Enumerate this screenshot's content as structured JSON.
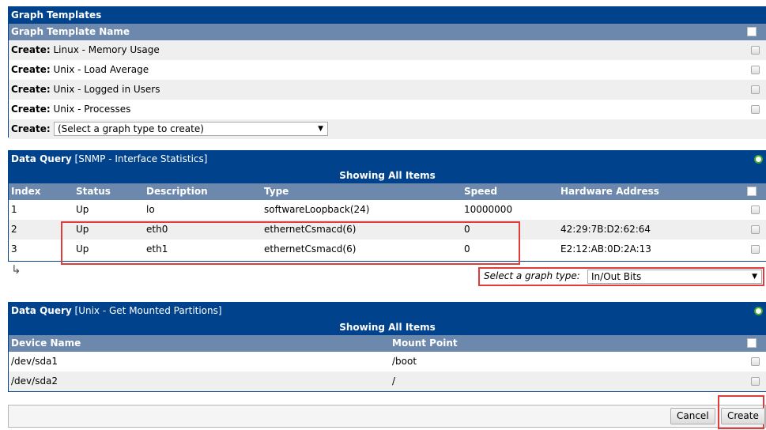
{
  "graph_templates": {
    "title": "Graph Templates",
    "column": "Graph Template Name",
    "rows": [
      {
        "prefix": "Create:",
        "name": "Linux - Memory Usage"
      },
      {
        "prefix": "Create:",
        "name": "Unix - Load Average"
      },
      {
        "prefix": "Create:",
        "name": "Unix - Logged in Users"
      },
      {
        "prefix": "Create:",
        "name": "Unix - Processes"
      }
    ],
    "create_label": "Create:",
    "create_select": "(Select a graph type to create)"
  },
  "dq1": {
    "label": "Data Query",
    "name": "[SNMP - Interface Statistics]",
    "showing": "Showing All Items",
    "columns": [
      "Index",
      "Status",
      "Description",
      "Type",
      "Speed",
      "Hardware Address"
    ],
    "rows": [
      [
        "1",
        "Up",
        "lo",
        "softwareLoopback(24)",
        "10000000",
        ""
      ],
      [
        "2",
        "Up",
        "eth0",
        "ethernetCsmacd(6)",
        "0",
        "42:29:7B:D2:62:64"
      ],
      [
        "3",
        "Up",
        "eth1",
        "ethernetCsmacd(6)",
        "0",
        "E2:12:AB:0D:2A:13"
      ]
    ],
    "select_label": "Select a graph type:",
    "select_value": "In/Out Bits",
    "arrow": "↳"
  },
  "dq2": {
    "label": "Data Query",
    "name": "[Unix - Get Mounted Partitions]",
    "showing": "Showing All Items",
    "columns": [
      "Device Name",
      "Mount Point"
    ],
    "rows": [
      [
        "/dev/sda1",
        "/boot"
      ],
      [
        "/dev/sda2",
        "/"
      ]
    ]
  },
  "actions": {
    "cancel": "Cancel",
    "create": "Create"
  },
  "colors": {
    "header": "#00438c",
    "column_header": "#6d88ad",
    "alt_row": "#efefef",
    "highlight": "#e23b3b",
    "status_ok": "#3aaa35"
  }
}
